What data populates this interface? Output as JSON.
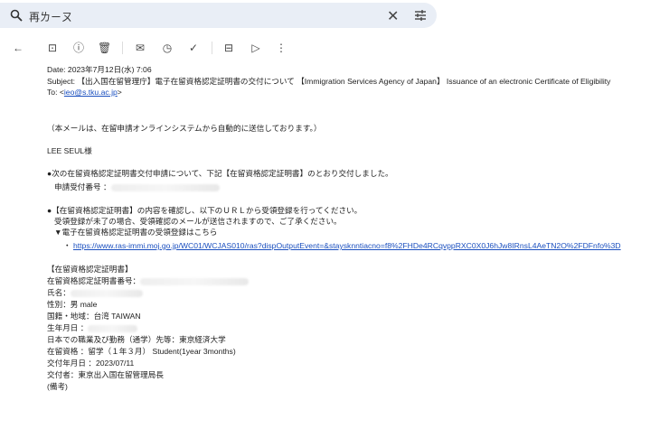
{
  "search": {
    "query": "再ㄌㄧㄡ"
  },
  "toolbar": {
    "icons": [
      "back-arrow",
      "archive",
      "report-spam",
      "delete",
      "mark-unread",
      "snooze",
      "add-to-tasks",
      "move-to",
      "label",
      "more"
    ]
  },
  "email": {
    "date": "Date: 2023年7月12日(水) 7:06",
    "subject": "Subject: 【出入国在留管理庁】電子在留資格認定証明書の交付について 【Immigration Services Agency of Japan】 Issuance of an electronic Certificate of Eligibility",
    "to_prefix": "To: <",
    "to_email": "ieo@s.tku.ac.jp",
    "to_suffix": ">",
    "notice": "（本メールは、在留申請オンラインシステムから自動的に送信しております。）",
    "greeting": "LEE SEUL様",
    "b1": "●次の在留資格認定証明書交付申請について、下記【在留資格認定証明書】のとおり交付しました。",
    "receipt_label": "申請受付番号 ：",
    "b2": "●【在留資格認定証明書】の内容を確認し、以下のＵＲＬから受領登録を行ってください。",
    "b2b": "受領登録が未了の場合、受領確認のメールが送信されますので、ご了承ください。",
    "b2c": "▼電子在留資格認定証明書の受領登録はこちら",
    "link_bullet": "・",
    "link": "https://www.ras-immi.moj.go.jp/WC01/WCJAS010/ras?dispOutputEvent=&staysknntiacno=f8%2FHDe4RCqvppRXC0X0J6hJw8IRnsL4AeTN2O%2FDFnfo%3D",
    "cert_head": "【在留資格認定証明書】",
    "cert_no": "在留資格認定証明書番号：",
    "name": "氏名：",
    "sex": "性別：男 male",
    "nationality": "国籍・地域：台湾 TAIWAN",
    "dob": "生年月日 ：",
    "employer": "日本での職業及び勤務（通学）先等：東京経済大学",
    "status": "在留資格 ：留学（１年３月） Student(1year 3months)",
    "issued": "交付年月日 ：2023/07/11",
    "issuer": "交付者：東京出入国在留管理局長",
    "remarks": "(備考)"
  }
}
